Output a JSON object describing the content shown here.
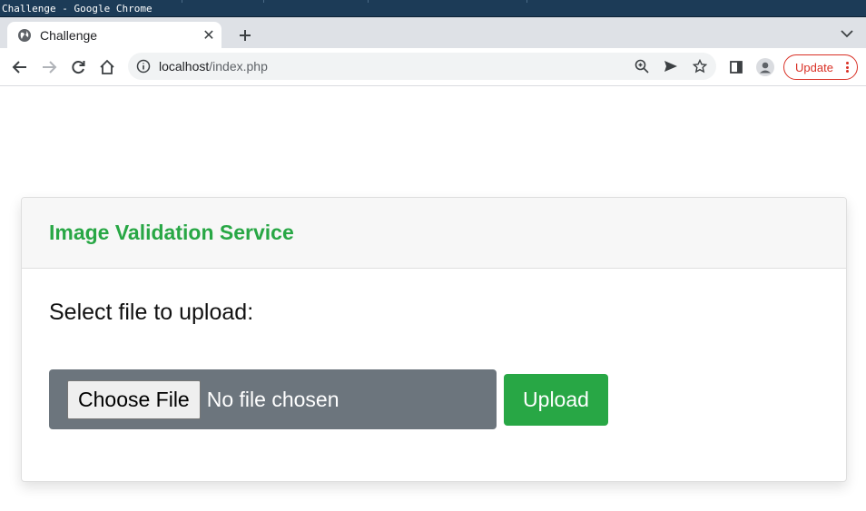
{
  "window": {
    "title": "Challenge - Google Chrome"
  },
  "browser": {
    "tab_title": "Challenge",
    "url_host": "localhost",
    "url_path": "/index.php",
    "update_label": "Update"
  },
  "page": {
    "header_title": "Image Validation Service",
    "prompt": "Select file to upload:",
    "file_input": {
      "button_label": "Choose File",
      "status": "No file chosen"
    },
    "upload_label": "Upload"
  },
  "colors": {
    "accent": "#28a745",
    "file_bg": "#6c757d",
    "update": "#d93025"
  }
}
